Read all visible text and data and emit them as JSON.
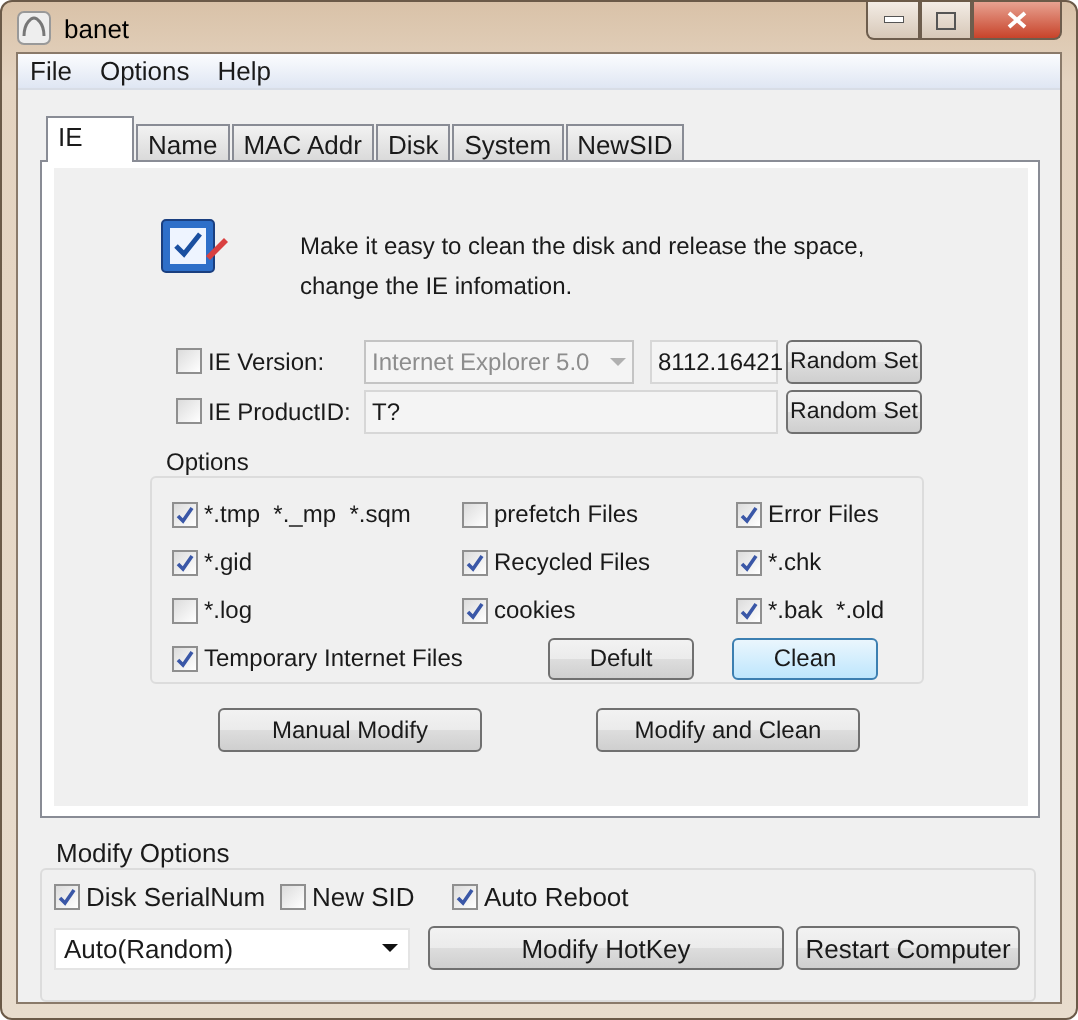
{
  "window": {
    "title": "banet"
  },
  "menu": [
    "File",
    "Options",
    "Help"
  ],
  "tabs": [
    {
      "label": "IE",
      "selected": true
    },
    {
      "label": "Name",
      "selected": false
    },
    {
      "label": "MAC Addr",
      "selected": false
    },
    {
      "label": "Disk",
      "selected": false
    },
    {
      "label": "System",
      "selected": false
    },
    {
      "label": "NewSID",
      "selected": false
    }
  ],
  "ie": {
    "description_lines": [
      "Make it easy to clean the disk and release the space,",
      "change the IE infomation."
    ],
    "version": {
      "label": "IE Version:",
      "checked": false,
      "value": "Internet Explorer 5.0",
      "build": "8112.16421",
      "button": "Random Set"
    },
    "product_id": {
      "label": "IE ProductID:",
      "checked": false,
      "value": "T?",
      "button": "Random Set"
    },
    "options": {
      "title": "Options",
      "items": [
        {
          "label": "*.tmp  *._mp  *.sqm",
          "checked": true
        },
        {
          "label": "prefetch Files",
          "checked": false
        },
        {
          "label": "Error Files",
          "checked": true
        },
        {
          "label": "*.gid",
          "checked": true
        },
        {
          "label": "Recycled Files",
          "checked": true
        },
        {
          "label": "*.chk",
          "checked": true
        },
        {
          "label": "*.log",
          "checked": false
        },
        {
          "label": "cookies",
          "checked": true
        },
        {
          "label": "*.bak  *.old",
          "checked": true
        },
        {
          "label": "Temporary Internet Files",
          "checked": true
        }
      ],
      "buttons": [
        {
          "label": "Defult",
          "focused": false
        },
        {
          "label": "Clean",
          "focused": true
        }
      ]
    },
    "actions": [
      "Manual Modify",
      "Modify and Clean"
    ]
  },
  "modify_options": {
    "title": "Modify Options",
    "checks": [
      {
        "label": "Disk SerialNum",
        "checked": true
      },
      {
        "label": "New SID",
        "checked": false
      },
      {
        "label": "Auto Reboot",
        "checked": true
      }
    ],
    "mode": "Auto(Random)",
    "buttons": [
      "Modify HotKey",
      "Restart Computer"
    ]
  }
}
